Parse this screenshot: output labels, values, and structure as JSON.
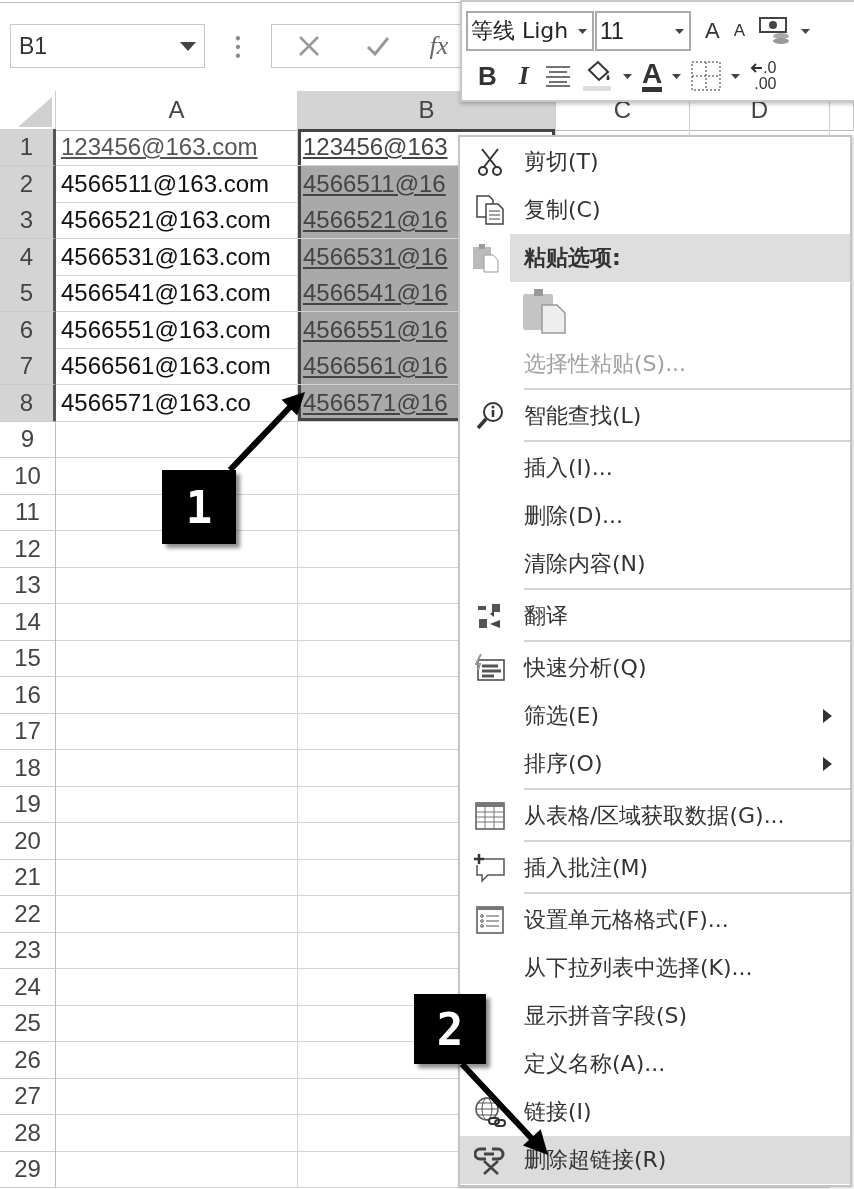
{
  "name_box": {
    "value": "B1"
  },
  "formula_bar": {
    "function_label": "fx"
  },
  "mini_toolbar": {
    "font": "等线 Ligh",
    "size": "11",
    "grow_font": "A",
    "shrink_font": "A",
    "bold": "B",
    "italic": "I",
    "font_color": "A",
    "decimal_top": ".0",
    "decimal_bottom": ".00"
  },
  "columns": [
    {
      "label": "A",
      "selected": false
    },
    {
      "label": "B",
      "selected": true
    },
    {
      "label": "C",
      "selected": false
    },
    {
      "label": "D",
      "selected": false
    }
  ],
  "rows": [
    {
      "number": "1",
      "selected": true,
      "cells": [
        {
          "text": "123456@163.com",
          "link": true,
          "selected": false
        },
        {
          "text": "123456@163",
          "link": true,
          "selected": false
        }
      ]
    },
    {
      "number": "2",
      "selected": true,
      "cells": [
        {
          "text": "4566511@163.com",
          "link": false,
          "selected": false
        },
        {
          "text": "4566511@16",
          "link": true,
          "selected": true
        }
      ]
    },
    {
      "number": "3",
      "selected": true,
      "cells": [
        {
          "text": "4566521@163.com",
          "link": false,
          "selected": false
        },
        {
          "text": "4566521@16",
          "link": true,
          "selected": true
        }
      ]
    },
    {
      "number": "4",
      "selected": true,
      "cells": [
        {
          "text": "4566531@163.com",
          "link": false,
          "selected": false
        },
        {
          "text": "4566531@16",
          "link": true,
          "selected": true
        }
      ]
    },
    {
      "number": "5",
      "selected": true,
      "cells": [
        {
          "text": "4566541@163.com",
          "link": false,
          "selected": false
        },
        {
          "text": "4566541@16",
          "link": true,
          "selected": true
        }
      ]
    },
    {
      "number": "6",
      "selected": true,
      "cells": [
        {
          "text": "4566551@163.com",
          "link": false,
          "selected": false
        },
        {
          "text": "4566551@16",
          "link": true,
          "selected": true
        }
      ]
    },
    {
      "number": "7",
      "selected": true,
      "cells": [
        {
          "text": "4566561@163.com",
          "link": false,
          "selected": false
        },
        {
          "text": "4566561@16",
          "link": true,
          "selected": true
        }
      ]
    },
    {
      "number": "8",
      "selected": true,
      "cells": [
        {
          "text": "4566571@163.co",
          "link": false,
          "selected": false
        },
        {
          "text": "4566571@16",
          "link": true,
          "selected": true
        }
      ]
    },
    {
      "number": "9",
      "selected": false
    },
    {
      "number": "10",
      "selected": false
    },
    {
      "number": "11",
      "selected": false
    },
    {
      "number": "12",
      "selected": false
    },
    {
      "number": "13",
      "selected": false
    },
    {
      "number": "14",
      "selected": false
    },
    {
      "number": "15",
      "selected": false
    },
    {
      "number": "16",
      "selected": false
    },
    {
      "number": "17",
      "selected": false
    },
    {
      "number": "18",
      "selected": false
    },
    {
      "number": "19",
      "selected": false
    },
    {
      "number": "20",
      "selected": false
    },
    {
      "number": "21",
      "selected": false
    },
    {
      "number": "22",
      "selected": false
    },
    {
      "number": "23",
      "selected": false
    },
    {
      "number": "24",
      "selected": false
    },
    {
      "number": "25",
      "selected": false
    },
    {
      "number": "26",
      "selected": false
    },
    {
      "number": "27",
      "selected": false
    },
    {
      "number": "28",
      "selected": false
    },
    {
      "number": "29",
      "selected": false
    }
  ],
  "context_menu": [
    {
      "kind": "item",
      "label": "剪切(T)",
      "disabled": false,
      "submenu": false,
      "selected": false
    },
    {
      "kind": "item",
      "label": "复制(C)",
      "disabled": false,
      "submenu": false,
      "selected": false
    },
    {
      "kind": "header",
      "label": "粘贴选项:"
    },
    {
      "kind": "paste-options"
    },
    {
      "kind": "item",
      "label": "选择性粘贴(S)...",
      "disabled": true,
      "submenu": false,
      "selected": false
    },
    {
      "kind": "separator"
    },
    {
      "kind": "item",
      "label": "智能查找(L)",
      "disabled": false,
      "submenu": false,
      "selected": false
    },
    {
      "kind": "separator"
    },
    {
      "kind": "item",
      "label": "插入(I)...",
      "disabled": false,
      "submenu": false,
      "selected": false
    },
    {
      "kind": "item",
      "label": "删除(D)...",
      "disabled": false,
      "submenu": false,
      "selected": false
    },
    {
      "kind": "item",
      "label": "清除内容(N)",
      "disabled": false,
      "submenu": false,
      "selected": false
    },
    {
      "kind": "separator"
    },
    {
      "kind": "item",
      "label": "翻译",
      "disabled": false,
      "submenu": false,
      "selected": false
    },
    {
      "kind": "separator"
    },
    {
      "kind": "item",
      "label": "快速分析(Q)",
      "disabled": false,
      "submenu": false,
      "selected": false
    },
    {
      "kind": "item",
      "label": "筛选(E)",
      "disabled": false,
      "submenu": true,
      "selected": false
    },
    {
      "kind": "item",
      "label": "排序(O)",
      "disabled": false,
      "submenu": true,
      "selected": false
    },
    {
      "kind": "separator"
    },
    {
      "kind": "item",
      "label": "从表格/区域获取数据(G)...",
      "disabled": false,
      "submenu": false,
      "selected": false
    },
    {
      "kind": "separator"
    },
    {
      "kind": "item",
      "label": "插入批注(M)",
      "disabled": false,
      "submenu": false,
      "selected": false
    },
    {
      "kind": "separator"
    },
    {
      "kind": "item",
      "label": "设置单元格格式(F)...",
      "disabled": false,
      "submenu": false,
      "selected": false
    },
    {
      "kind": "item",
      "label": "从下拉列表中选择(K)...",
      "disabled": false,
      "submenu": false,
      "selected": false
    },
    {
      "kind": "item",
      "label": "显示拼音字段(S)",
      "disabled": false,
      "submenu": false,
      "selected": false
    },
    {
      "kind": "item",
      "label": "定义名称(A)...",
      "disabled": false,
      "submenu": false,
      "selected": false
    },
    {
      "kind": "item",
      "label": "链接(I)",
      "disabled": false,
      "submenu": false,
      "selected": false
    },
    {
      "kind": "item",
      "label": "删除超链接(R)",
      "disabled": false,
      "submenu": false,
      "selected": true
    }
  ],
  "callouts": [
    {
      "label": "1"
    },
    {
      "label": "2"
    }
  ]
}
